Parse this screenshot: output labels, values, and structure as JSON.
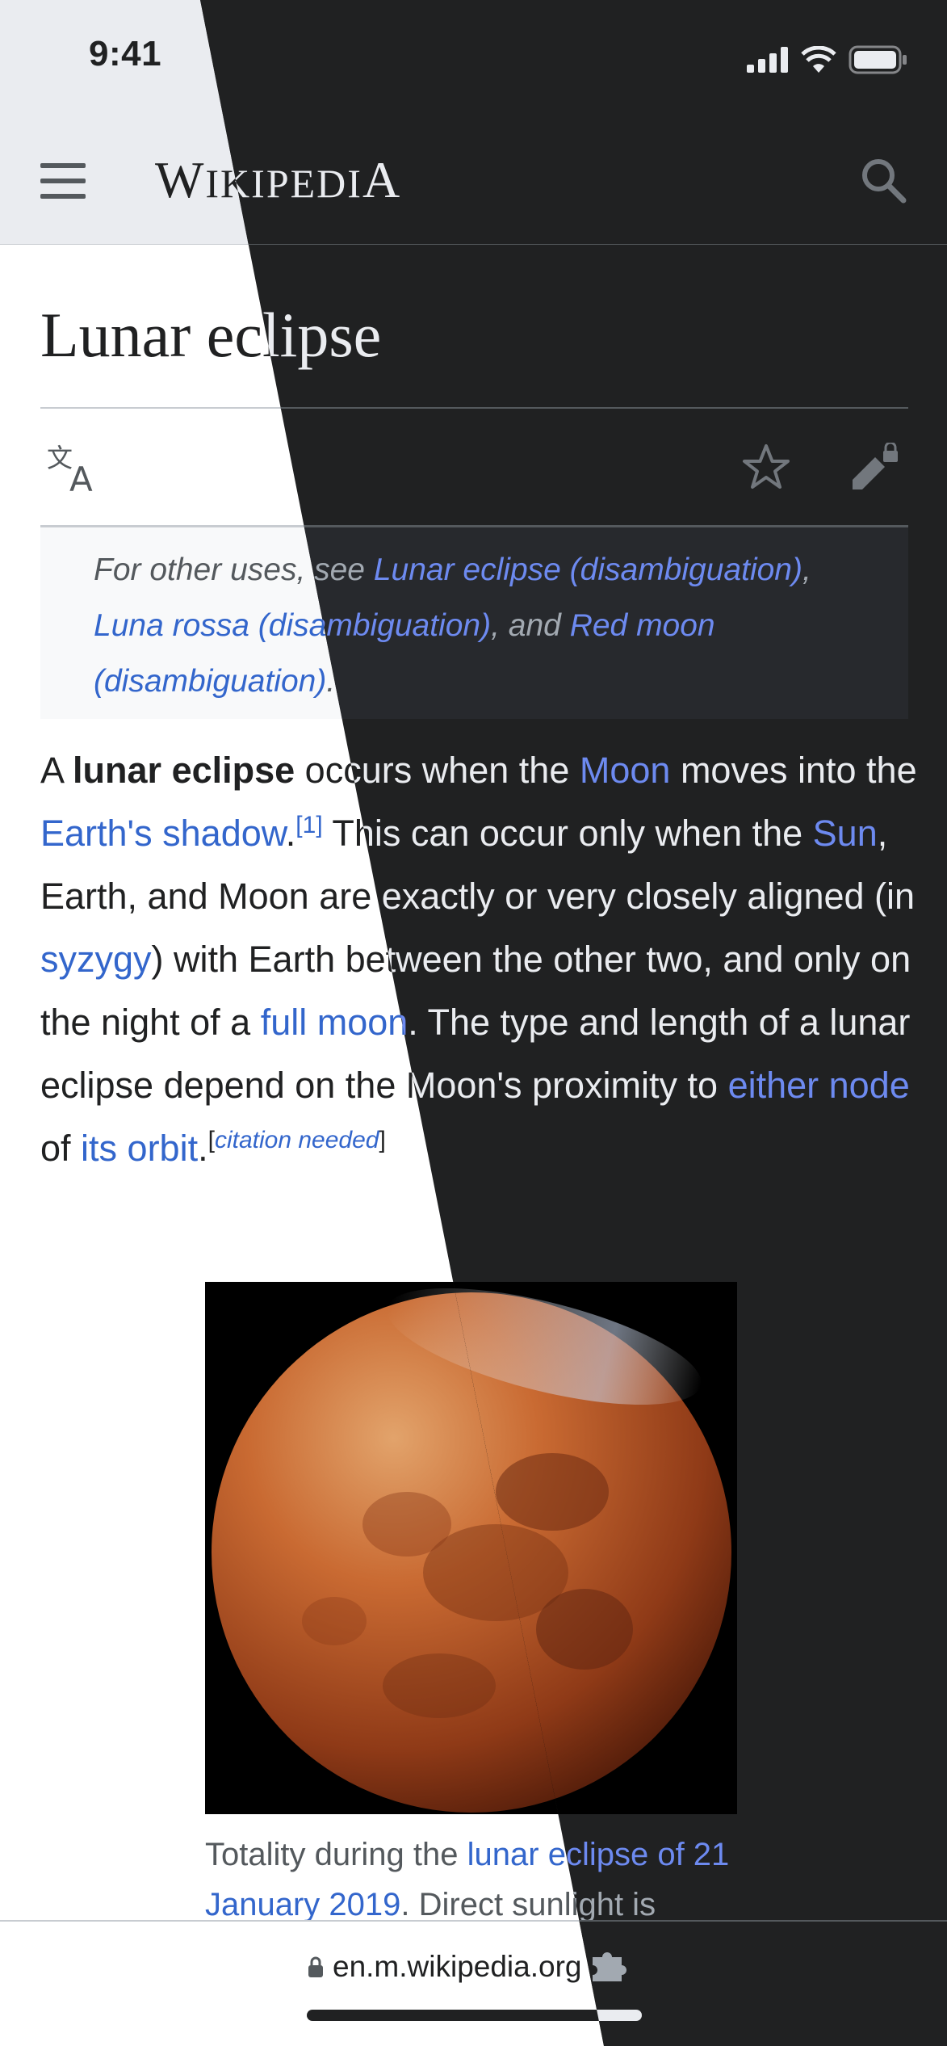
{
  "status_bar": {
    "time": "9:41"
  },
  "header": {
    "logo_w": "W",
    "logo_rest": "IKIPEDI",
    "logo_a": "A"
  },
  "article": {
    "title": "Lunar eclipse",
    "hatnote": {
      "lead": "For other uses, see ",
      "link1": "Lunar eclipse (disambiguation)",
      "sep1": ", ",
      "link2": "Luna rossa (disambiguation)",
      "sep2": ", and ",
      "link3": "Red moon (disambiguation)",
      "end": "."
    },
    "paragraph": {
      "t1": "A ",
      "bold": "lunar eclipse",
      "t2": " occurs when the ",
      "l_moon": "Moon",
      "t3": " moves into the ",
      "l_shadow": "Earth's shadow",
      "t4": ".",
      "ref1": "[1]",
      "t5": " This can occur only when the ",
      "l_sun": "Sun",
      "t6": ", Earth, and Moon are exactly or very closely aligned (in ",
      "l_syzygy": "syzygy",
      "t7": ") with Earth between the other two, and only on the night of a ",
      "l_fullmoon": "full moon",
      "t8": ". The type and length of a lunar eclipse depend on the Moon's proximity to ",
      "l_node": "either node",
      "t9": " of ",
      "l_orbit": "its orbit",
      "t10": ".",
      "cn_open": "[",
      "cn_text": "citation needed",
      "cn_close": "]"
    },
    "figure": {
      "caption_lead": "Totality during the ",
      "caption_link": "lunar eclipse of 21 January 2019",
      "caption_rest": ". Direct sunlight is"
    }
  },
  "browser": {
    "url": "en.m.wikipedia.org"
  },
  "icons": {
    "menu": "menu-icon",
    "search": "search-icon",
    "language": "language-icon",
    "watch": "star-icon",
    "edit": "edit-locked-icon",
    "lock": "lock-icon",
    "extension": "puzzle-icon"
  }
}
